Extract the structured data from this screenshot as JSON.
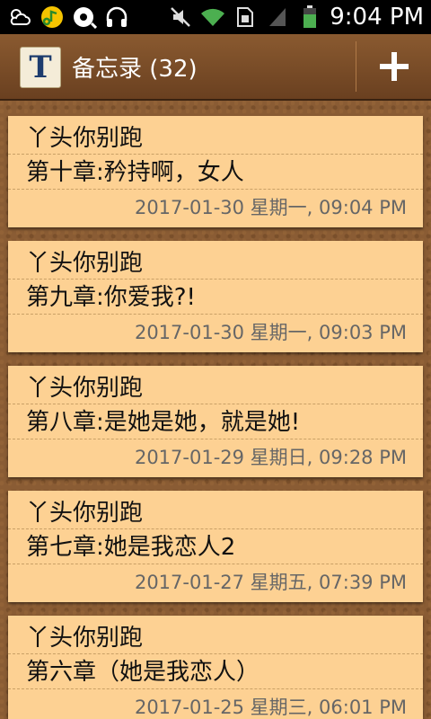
{
  "status_bar": {
    "time": "9:04 PM",
    "icons": [
      "weather-icon",
      "music-app-icon",
      "qq-music-icon",
      "headphones-icon",
      "mute-icon",
      "wifi-icon",
      "sim-icon",
      "signal-icon",
      "battery-icon"
    ]
  },
  "action_bar": {
    "app_icon_letter": "T",
    "title": "备忘录 (32)",
    "add_label": "+"
  },
  "notes": [
    {
      "title": "丫头你别跑",
      "chapter": "第十章:矜持啊，女人",
      "date": "2017-01-30 星期一, 09:04 PM"
    },
    {
      "title": "丫头你别跑",
      "chapter": "第九章:你爱我?!",
      "date": "2017-01-30 星期一, 09:03 PM"
    },
    {
      "title": "丫头你别跑",
      "chapter": "第八章:是她是她，就是她!",
      "date": "2017-01-29 星期日, 09:28 PM"
    },
    {
      "title": "丫头你别跑",
      "chapter": "第七章:她是我恋人2",
      "date": "2017-01-27 星期五, 07:39 PM"
    },
    {
      "title": "丫头你别跑",
      "chapter": "第六章（她是我恋人）",
      "date": "2017-01-25 星期三, 06:01 PM"
    }
  ],
  "colors": {
    "note_bg": "#fdd193",
    "cork": "#8a5c34",
    "date_text": "#666666"
  }
}
